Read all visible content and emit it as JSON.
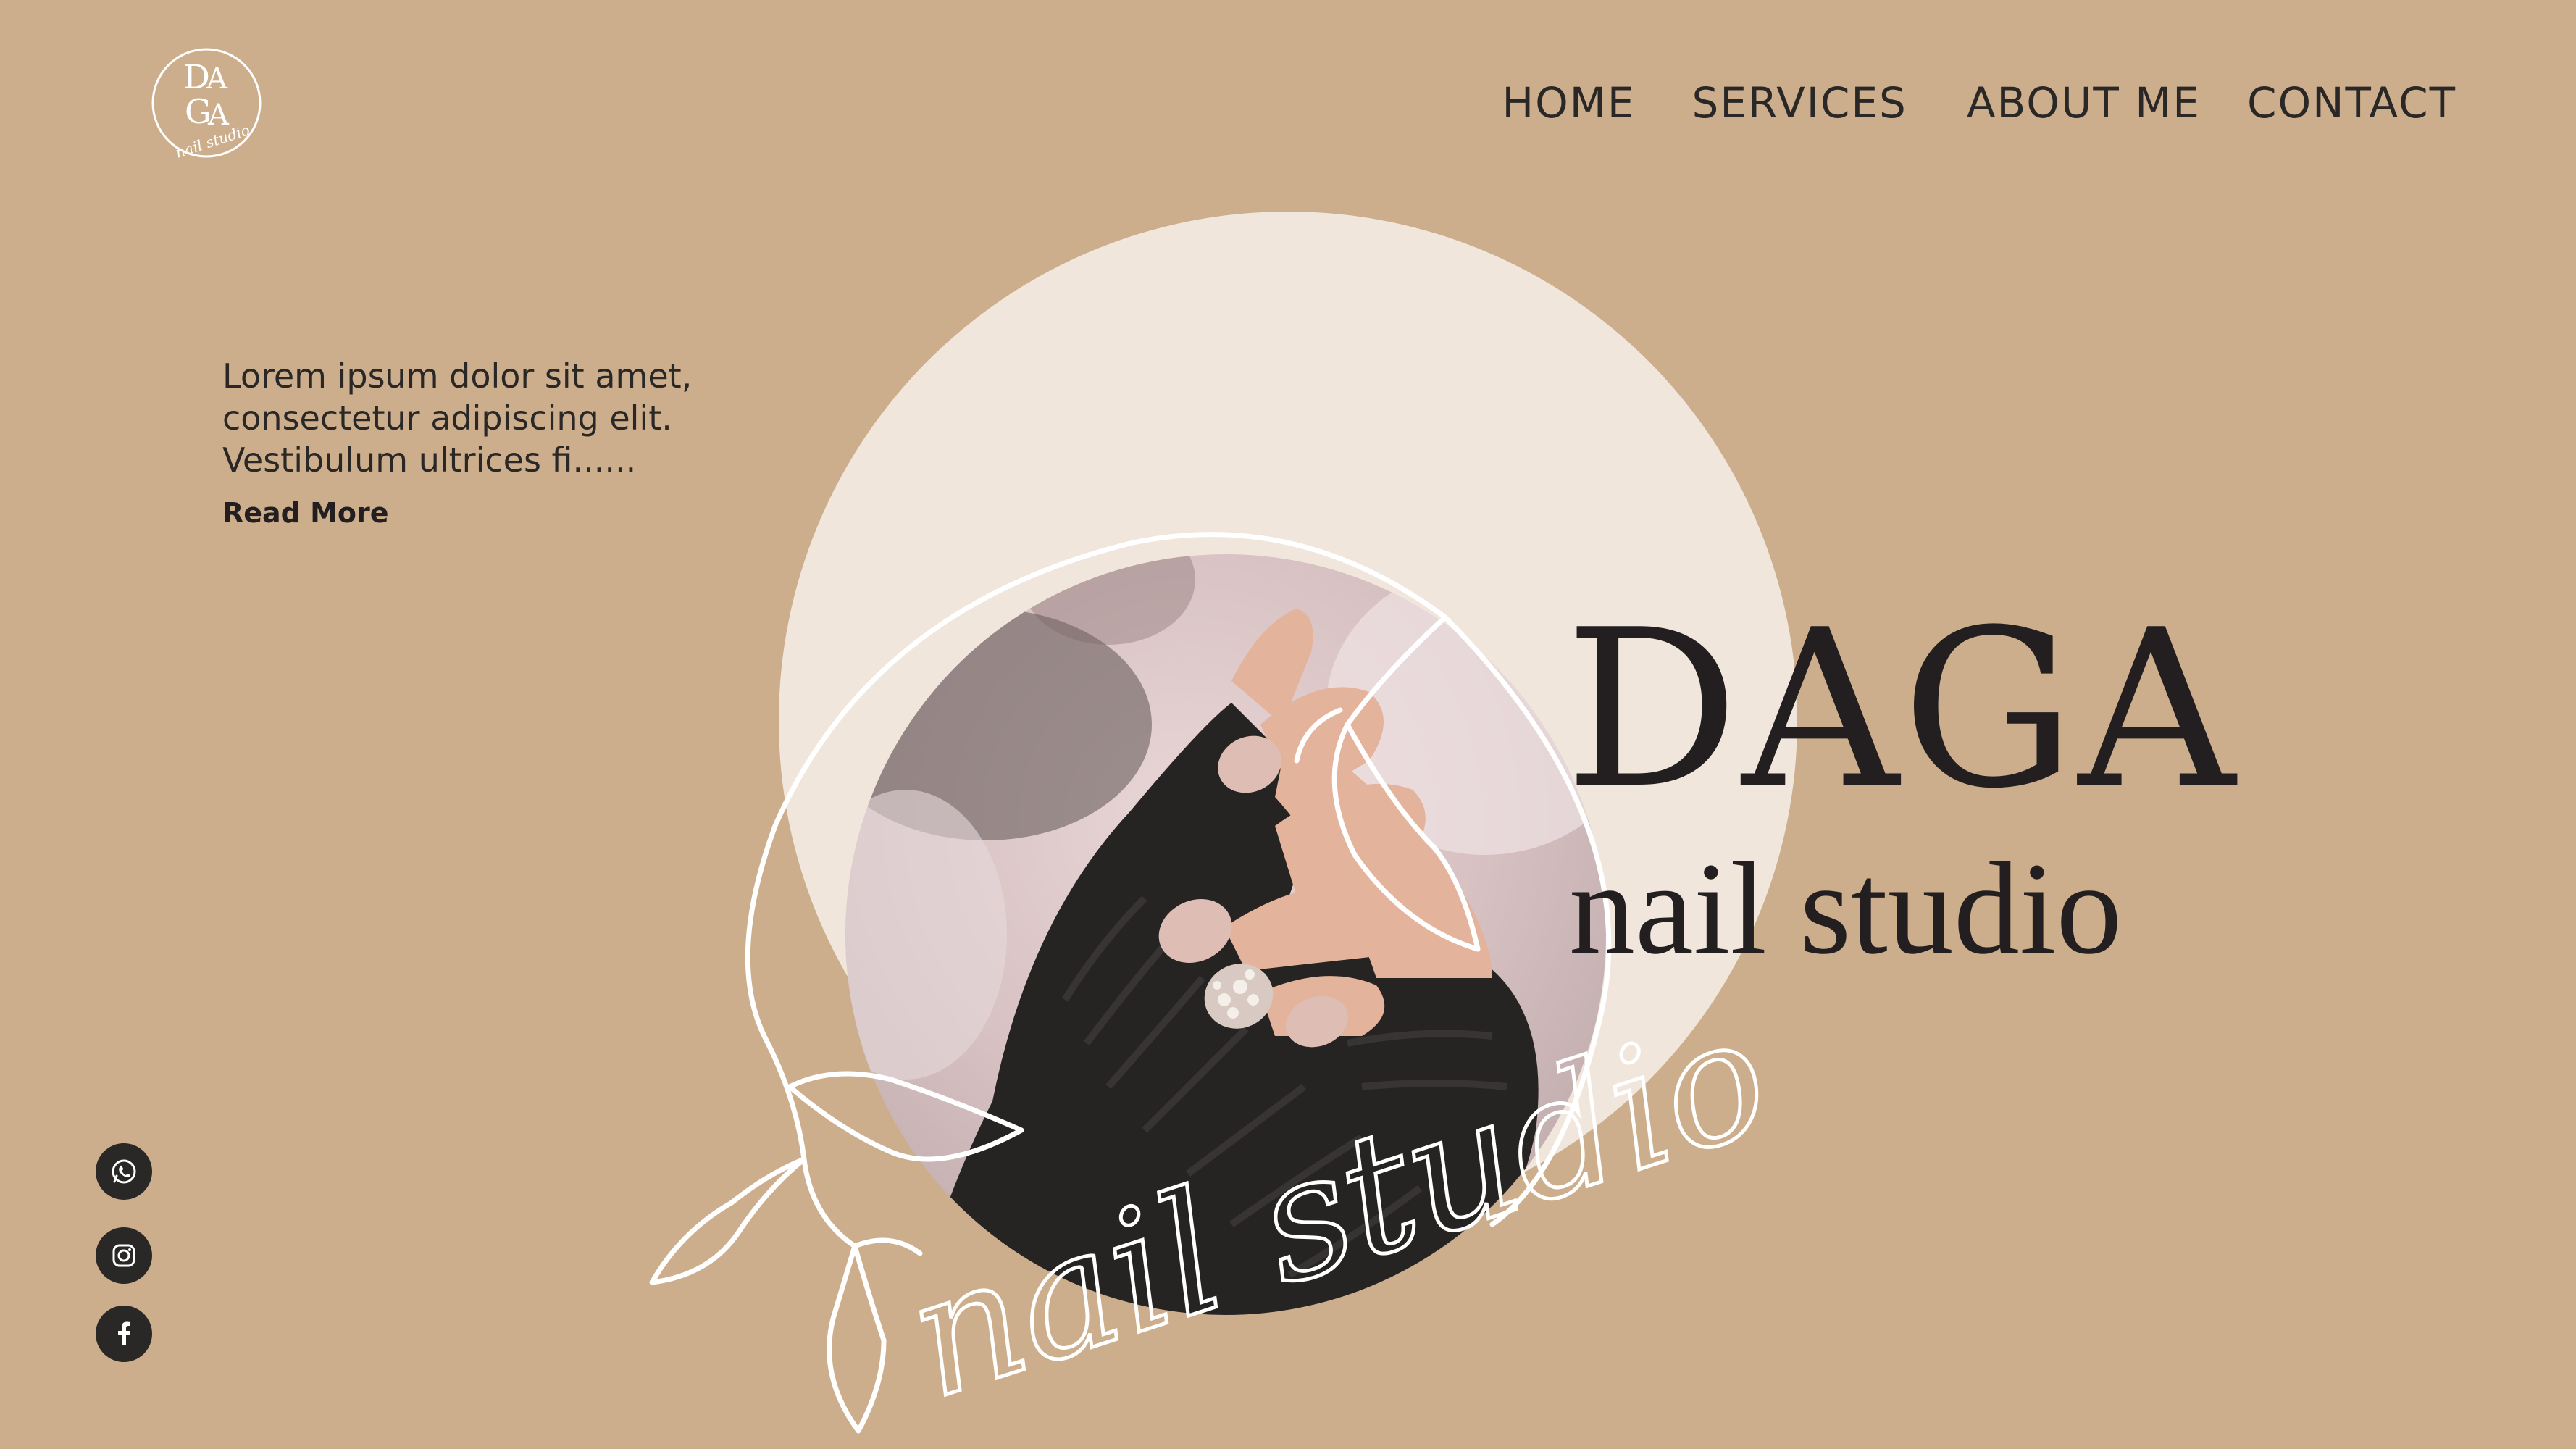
{
  "logo": {
    "monogram_top": "D",
    "monogram_mid": "A",
    "monogram_bottom": "G",
    "monogram_end": "A",
    "script_text": "nail studio"
  },
  "nav": {
    "items": [
      {
        "label": "HOME"
      },
      {
        "label": "SERVICES"
      },
      {
        "label": "ABOUT ME"
      },
      {
        "label": "CONTACT"
      }
    ]
  },
  "intro": {
    "text": "Lorem ipsum dolor sit amet,\nconsectetur adipiscing elit.\nVestibulum ultrices fi......",
    "read_more": "Read More"
  },
  "brand": {
    "name": "DAGA",
    "subtitle": "nail studio",
    "script_overlay": "nail studio"
  },
  "socials": [
    {
      "icon": "whatsapp-icon"
    },
    {
      "icon": "instagram-icon"
    },
    {
      "icon": "facebook-icon"
    }
  ],
  "colors": {
    "background": "#cdae8c",
    "circle_light": "#f0e6dc",
    "text_dark": "#231f20",
    "line_white": "#ffffff"
  }
}
